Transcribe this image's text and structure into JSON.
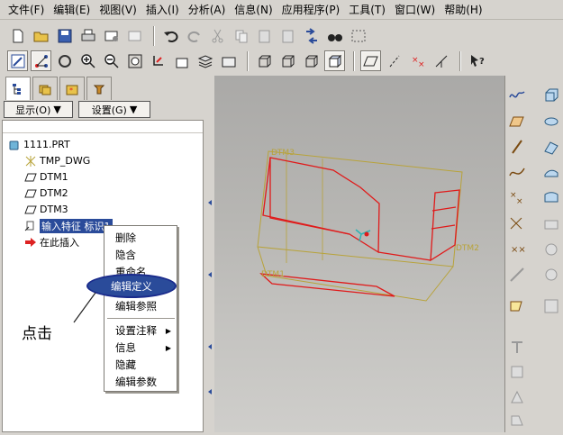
{
  "menu": [
    {
      "label": "文件(F)",
      "name": "menu-file"
    },
    {
      "label": "编辑(E)",
      "name": "menu-edit"
    },
    {
      "label": "视图(V)",
      "name": "menu-view"
    },
    {
      "label": "插入(I)",
      "name": "menu-insert"
    },
    {
      "label": "分析(A)",
      "name": "menu-analysis"
    },
    {
      "label": "信息(N)",
      "name": "menu-info"
    },
    {
      "label": "应用程序(P)",
      "name": "menu-applications"
    },
    {
      "label": "工具(T)",
      "name": "menu-tools"
    },
    {
      "label": "窗口(W)",
      "name": "menu-window"
    },
    {
      "label": "帮助(H)",
      "name": "menu-help"
    }
  ],
  "navigator": {
    "show_label": "显示(O)",
    "settings_label": "设置(G)"
  },
  "tree": {
    "root": "1111.PRT",
    "items": [
      "TMP_DWG",
      "DTM1",
      "DTM2",
      "DTM3"
    ],
    "selected": "输入特征 标识1",
    "insert_here": "在此插入"
  },
  "context_menu": {
    "items": [
      "删除",
      "隐含",
      "重命名",
      "编辑定义",
      "编辑参照",
      "设置注释",
      "信息",
      "隐藏",
      "编辑参数"
    ],
    "highlighted": "编辑定义"
  },
  "annotation": {
    "text": "点击"
  },
  "viewport": {
    "labels": {
      "dtm1": "DTM1",
      "dtm2": "DTM2",
      "dtm3": "DTM3"
    },
    "colors": {
      "datum": "#b8a33a",
      "edge": "#e01a1a",
      "background": "#b7b6b3"
    }
  },
  "colors": {
    "selection": "#2a4b9a",
    "chrome": "#d6d3ce"
  }
}
